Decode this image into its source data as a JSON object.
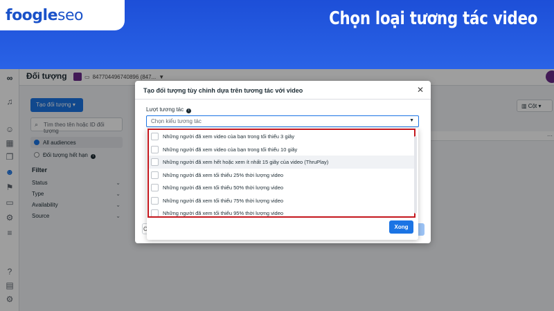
{
  "banner": {
    "logo_part1": "foogle",
    "logo_part2": "seo",
    "title": "Chọn loại tương tác video"
  },
  "app": {
    "page_title": "Đối tượng",
    "account_id": "847704496740896 (847...",
    "create_button": "Tạo đối tượng",
    "search_placeholder": "Tìm theo tên hoặc ID đối tượng",
    "audiences": {
      "all": "All audiences",
      "expired": "Đối tượng hết hạn"
    },
    "filter_title": "Filter",
    "filters": [
      "Status",
      "Type",
      "Availability",
      "Source"
    ],
    "columns_button": "Cột"
  },
  "modal": {
    "title": "Tạo đối tượng tùy chỉnh dựa trên tương tác với video",
    "field_label": "Lượt tương tác",
    "select_placeholder": "Chọn kiểu tương tác",
    "options": [
      "Những người đã xem video của bạn trong tối thiểu 3 giây",
      "Những người đã xem video của bạn trong tối thiểu 10 giây",
      "Những người đã xem hết hoặc xem ít nhất 15 giây của video (ThruPlay)",
      "Những người đã xem tối thiểu 25% thời lượng video",
      "Những người đã xem tối thiểu 50% thời lượng video",
      "Những người đã xem tối thiểu 75% thời lượng video",
      "Những người đã xem tối thiểu 95% thời lượng video"
    ],
    "done_button": "Xong"
  },
  "colors": {
    "brand_blue": "#1b74e4",
    "highlight_red": "#c4161c",
    "banner_blue": "#2a63e6"
  }
}
